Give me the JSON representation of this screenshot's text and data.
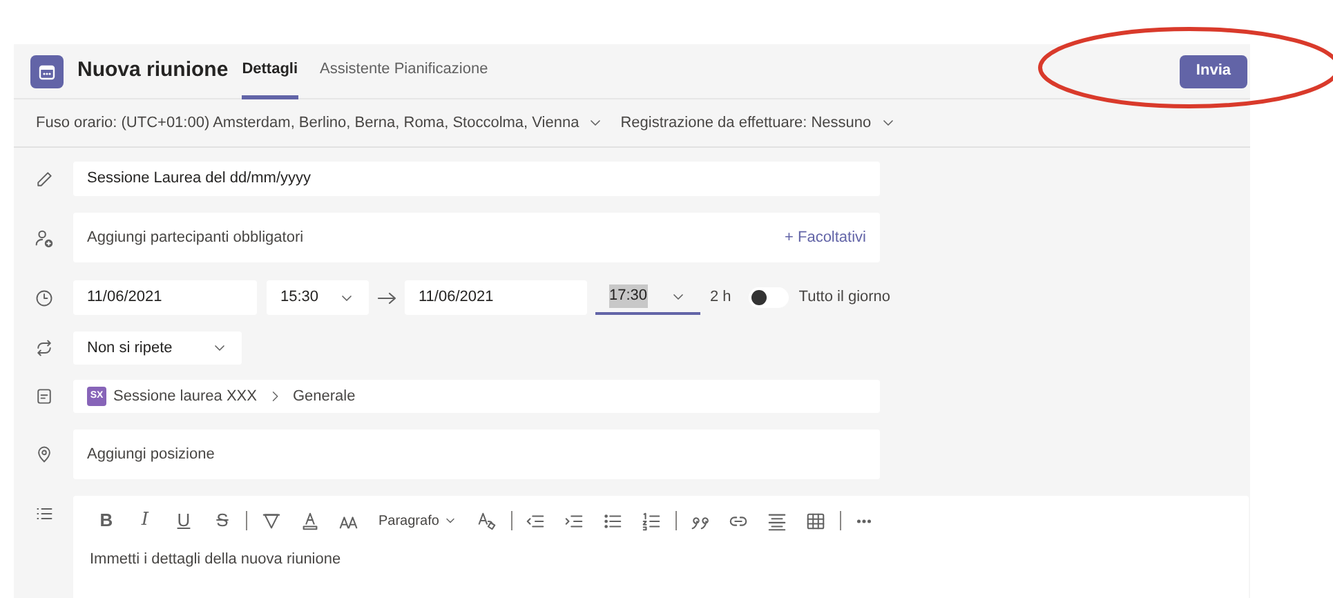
{
  "header": {
    "title": "Nuova riunione",
    "tabs": [
      {
        "label": "Dettagli",
        "selected": true
      },
      {
        "label": "Assistente Pianificazione",
        "selected": false
      }
    ],
    "send_button": "Invia"
  },
  "options_bar": [
    {
      "label": "Fuso orario: (UTC+01:00) Amsterdam, Berlino, Berna, Roma, Stoccolma, Vienna"
    },
    {
      "label": "Registrazione da effettuare: Nessuno"
    }
  ],
  "title_field": {
    "value": "Sessione Laurea del dd/mm/yyyy"
  },
  "attendees_field": {
    "placeholder": "Aggiungi partecipanti obbligatori",
    "optional_link": "+ Facoltativi"
  },
  "schedule": {
    "start_date": "11/06/2021",
    "start_time": "15:30",
    "end_date": "11/06/2021",
    "end_time": "17:30",
    "duration": "2 h",
    "all_day": {
      "label": "Tutto il giorno",
      "on": false
    }
  },
  "repeat": {
    "value": "Non si ripete"
  },
  "channel": {
    "badge": "SX",
    "team": "Sessione laurea XXX",
    "name": "Generale"
  },
  "location_field": {
    "placeholder": "Aggiungi posizione"
  },
  "editor": {
    "toolbar": [
      {
        "kind": "bold",
        "label": "B"
      },
      {
        "kind": "italic",
        "label": "I"
      },
      {
        "kind": "underline",
        "label": "U"
      },
      {
        "kind": "strike",
        "label": "S"
      },
      {
        "kind": "separator"
      },
      {
        "kind": "highlight"
      },
      {
        "kind": "font-color"
      },
      {
        "kind": "font-size"
      },
      {
        "kind": "dropdown",
        "label": "Paragrafo"
      },
      {
        "kind": "clear-format"
      },
      {
        "kind": "separator"
      },
      {
        "kind": "outdent"
      },
      {
        "kind": "indent"
      },
      {
        "kind": "bullets"
      },
      {
        "kind": "numbering"
      },
      {
        "kind": "separator"
      },
      {
        "kind": "quote"
      },
      {
        "kind": "link"
      },
      {
        "kind": "align"
      },
      {
        "kind": "table"
      },
      {
        "kind": "separator"
      },
      {
        "kind": "more"
      }
    ],
    "placeholder": "Immetti i dettagli della nuova riunione"
  }
}
